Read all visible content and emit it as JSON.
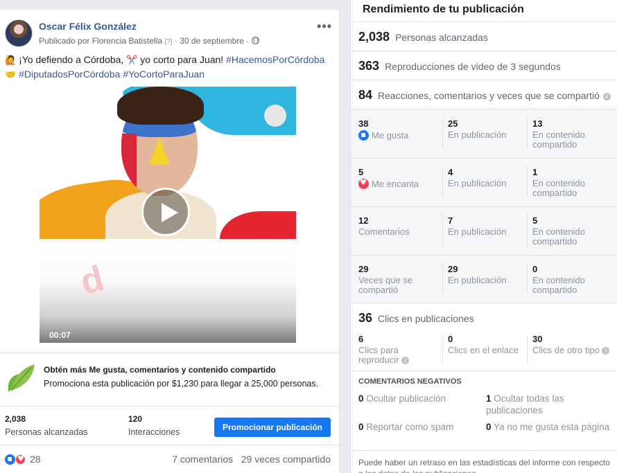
{
  "post": {
    "author": "Oscar Félix González",
    "meta_prefix": "Publicado por Florencia Batistella",
    "meta_q": "[?]",
    "meta_date": " · 30 de septiembre · ",
    "text_line1_a": " ¡Yo defiendo a Córdoba, ",
    "text_line1_b": " yo corto para Juan! ",
    "hashtag1": "#HacemosPorCórdoba",
    "hashtag2": "#DiputadosPorCórdoba",
    "hashtag3": "#YoCortoParaJuan",
    "video_duration": "00:07",
    "promo_title": "Obtén más Me gusta, comentarios y contenido compartido",
    "promo_sub": "Promociona esta publicación por $1,230 para llegar a 25,000 personas.",
    "reach_num": "2,038",
    "reach_label": "Personas alcanzadas",
    "interactions_num": "120",
    "interactions_label": "Interacciones",
    "promote_button": "Promocionar publicación",
    "reactions_count": "28",
    "comments": "7 comentarios",
    "shares": "29 veces compartido"
  },
  "panel": {
    "title": "Rendimiento de tu publicación",
    "reach_num": "2,038",
    "reach_label": "Personas alcanzadas",
    "views_num": "363",
    "views_label": "Reproducciones de video de 3 segundos",
    "engage_num": "84",
    "engage_label": "Reacciones, comentarios y veces que se compartió",
    "grid": [
      {
        "total": "38",
        "label": "Me gusta",
        "on_post": "25",
        "on_post_label": "En publicación",
        "shared": "13",
        "shared_label": "En contenido compartido"
      },
      {
        "total": "5",
        "label": "Me encanta",
        "on_post": "4",
        "on_post_label": "En publicación",
        "shared": "1",
        "shared_label": "En contenido compartido"
      },
      {
        "total": "12",
        "label": "Comentarios",
        "on_post": "7",
        "on_post_label": "En publicación",
        "shared": "5",
        "shared_label": "En contenido compartido"
      },
      {
        "total": "29",
        "label": "Veces que se compartió",
        "on_post": "29",
        "on_post_label": "En publicación",
        "shared": "0",
        "shared_label": "En contenido compartido"
      }
    ],
    "clicks_num": "36",
    "clicks_label": "Clics en publicaciones",
    "clicks": [
      {
        "num": "6",
        "label": "Clics para reproducir"
      },
      {
        "num": "0",
        "label": "Clics en el enlace"
      },
      {
        "num": "30",
        "label": "Clics de otro tipo"
      }
    ],
    "neg_title": "COMENTARIOS NEGATIVOS",
    "neg": [
      {
        "num": "0",
        "label": "Ocultar publicación"
      },
      {
        "num": "1",
        "label": "Ocultar todas las publicaciones"
      },
      {
        "num": "0",
        "label": "Reportar como spam"
      },
      {
        "num": "0",
        "label": "Ya no me gusta esta página"
      }
    ],
    "note": "Puede haber un retraso en las estadísticas del informe con respecto a los datos de las publicaciones"
  }
}
